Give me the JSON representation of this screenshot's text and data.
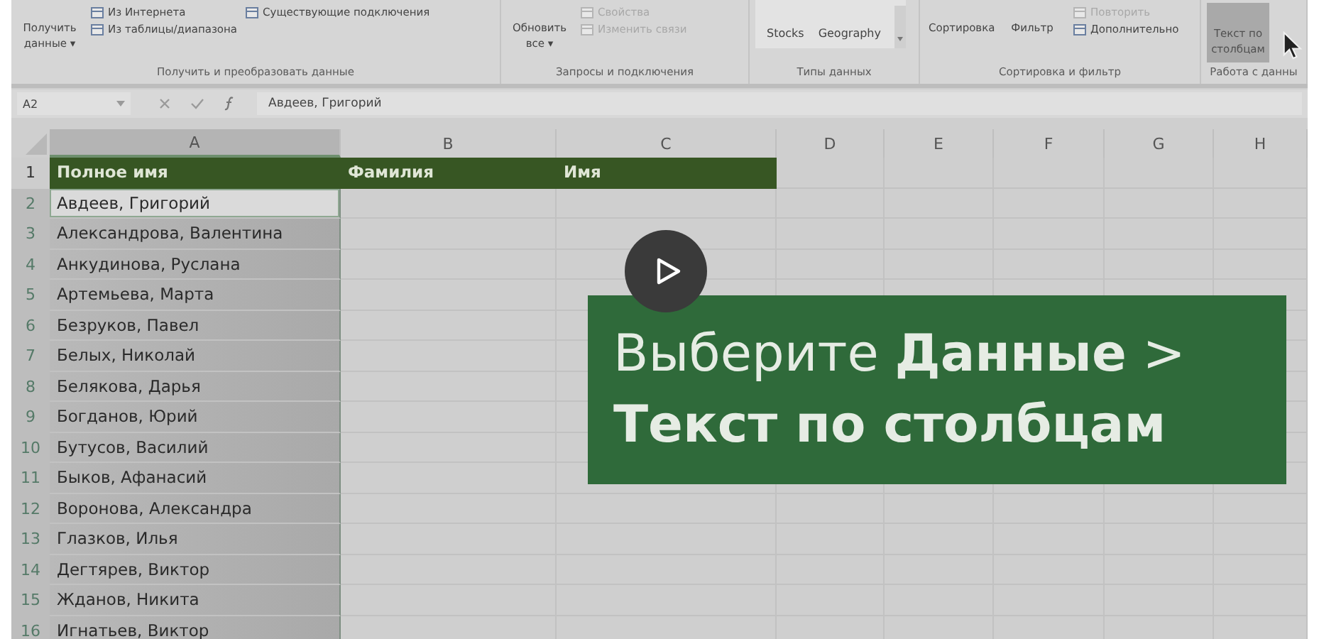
{
  "ribbon": {
    "groups": [
      {
        "label": "Получить и преобразовать данные",
        "items": [
          {
            "kind": "large",
            "text": "Получить данные ▾",
            "selected": false
          },
          {
            "kind": "stack",
            "entries": [
              {
                "text": "Из Интернета",
                "disabled": false
              },
              {
                "text": "Из таблицы/диапазона",
                "disabled": false
              }
            ]
          },
          {
            "kind": "stack",
            "entries": [
              {
                "text": "Существующие подключения",
                "disabled": false
              }
            ]
          }
        ]
      },
      {
        "label": "Запросы и подключения",
        "items": [
          {
            "kind": "large",
            "text": "Обновить все ▾",
            "selected": false
          },
          {
            "kind": "stack",
            "entries": [
              {
                "text": "Свойства",
                "disabled": true
              },
              {
                "text": "Изменить связи",
                "disabled": true
              }
            ]
          }
        ]
      },
      {
        "label": "Типы данных",
        "items": [
          {
            "kind": "gallery",
            "entries": [
              "Stocks",
              "Geography"
            ]
          }
        ]
      },
      {
        "label": "Сортировка и фильтр",
        "items": [
          {
            "kind": "large",
            "text": "Сортировка",
            "selected": false
          },
          {
            "kind": "large",
            "text": "Фильтр",
            "selected": false
          },
          {
            "kind": "stack",
            "entries": [
              {
                "text": "Повторить",
                "disabled": true
              },
              {
                "text": "Дополнительно",
                "disabled": false
              }
            ]
          }
        ]
      },
      {
        "label": "Работа с данны",
        "items": [
          {
            "kind": "large",
            "text": "Текст по столбцам",
            "selected": true
          }
        ]
      }
    ]
  },
  "formula_bar": {
    "cell_ref": "A2",
    "value": "Авдеев, Григорий"
  },
  "columns": [
    {
      "label": "A",
      "selected": true
    },
    {
      "label": "B",
      "selected": false
    },
    {
      "label": "C",
      "selected": false
    },
    {
      "label": "D",
      "selected": false
    },
    {
      "label": "E",
      "selected": false
    },
    {
      "label": "F",
      "selected": false
    },
    {
      "label": "G",
      "selected": false
    },
    {
      "label": "H",
      "selected": false
    }
  ],
  "rows": [
    {
      "number": "1",
      "kind": "header",
      "selected": false,
      "active": false,
      "cells": [
        "Полное имя",
        "Фамилия",
        "Имя"
      ]
    },
    {
      "number": "2",
      "kind": "data",
      "selected": true,
      "active": true,
      "cells": [
        "Авдеев, Григорий"
      ]
    },
    {
      "number": "3",
      "kind": "data",
      "selected": true,
      "active": false,
      "cells": [
        "Александрова, Валентина"
      ]
    },
    {
      "number": "4",
      "kind": "data",
      "selected": true,
      "active": false,
      "cells": [
        "Анкудинова, Руслана"
      ]
    },
    {
      "number": "5",
      "kind": "data",
      "selected": true,
      "active": false,
      "cells": [
        "Артемьева, Марта"
      ]
    },
    {
      "number": "6",
      "kind": "data",
      "selected": true,
      "active": false,
      "cells": [
        "Безруков, Павел"
      ]
    },
    {
      "number": "7",
      "kind": "data",
      "selected": true,
      "active": false,
      "cells": [
        "Белых, Николай"
      ]
    },
    {
      "number": "8",
      "kind": "data",
      "selected": true,
      "active": false,
      "cells": [
        "Белякова, Дарья"
      ]
    },
    {
      "number": "9",
      "kind": "data",
      "selected": true,
      "active": false,
      "cells": [
        "Богданов, Юрий"
      ]
    },
    {
      "number": "10",
      "kind": "data",
      "selected": true,
      "active": false,
      "cells": [
        "Бутусов, Василий"
      ]
    },
    {
      "number": "11",
      "kind": "data",
      "selected": true,
      "active": false,
      "cells": [
        "Быков, Афанасий"
      ]
    },
    {
      "number": "12",
      "kind": "data",
      "selected": true,
      "active": false,
      "cells": [
        "Воронова, Александра"
      ]
    },
    {
      "number": "13",
      "kind": "data",
      "selected": true,
      "active": false,
      "cells": [
        "Глазков, Илья"
      ]
    },
    {
      "number": "14",
      "kind": "data",
      "selected": true,
      "active": false,
      "cells": [
        "Дегтярев, Виктор"
      ]
    },
    {
      "number": "15",
      "kind": "data",
      "selected": true,
      "active": false,
      "cells": [
        "Жданов, Никита"
      ]
    },
    {
      "number": "16",
      "kind": "data",
      "selected": true,
      "active": false,
      "cells": [
        "Игнатьев, Виктор"
      ]
    }
  ],
  "banner": {
    "line_1": "Выберите **Данные** >",
    "line_2": "Текст по столбцам"
  }
}
